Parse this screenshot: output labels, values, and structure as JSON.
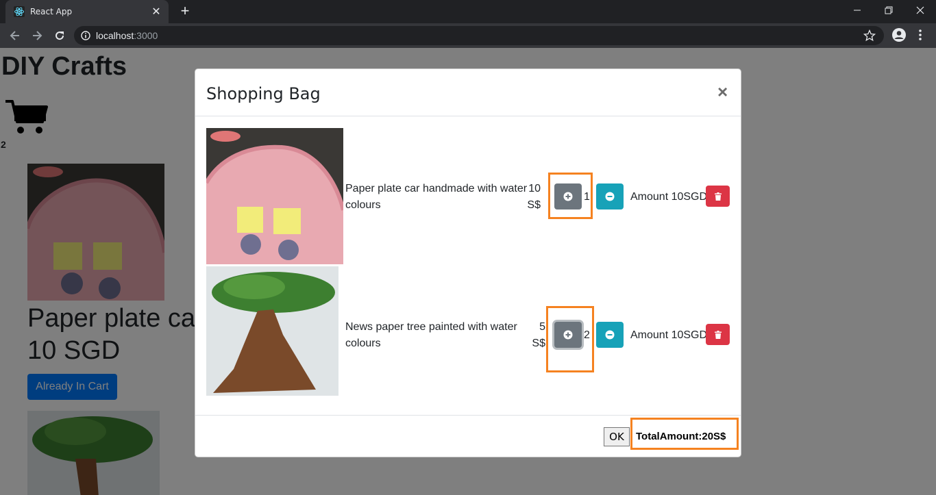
{
  "browser": {
    "tab_title": "React App",
    "url_host": "localhost",
    "url_port": ":3000"
  },
  "page": {
    "site_title": "DIY Crafts",
    "cart_count": "2",
    "product_title_line1": "Paper plate ca",
    "product_title_line2": "10 SGD",
    "cart_button": "Already In Cart"
  },
  "modal": {
    "title": "Shopping Bag",
    "close": "×",
    "items": [
      {
        "description": "Paper plate car handmade with water colours",
        "price_line1": "10",
        "price_line2": "S$",
        "quantity": "1",
        "amount": "Amount 10SGD"
      },
      {
        "description": "News paper tree painted with water colours",
        "price_line1": "5",
        "price_line2": "S$",
        "quantity": "2",
        "amount": "Amount 10SGD"
      }
    ],
    "ok_label": "OK",
    "total": "TotalAmount:20S$"
  },
  "colors": {
    "plus_button": "#6c757d",
    "minus_button": "#17a2b8",
    "delete_button": "#dc3545",
    "highlight": "#f58220",
    "primary": "#007bff"
  }
}
